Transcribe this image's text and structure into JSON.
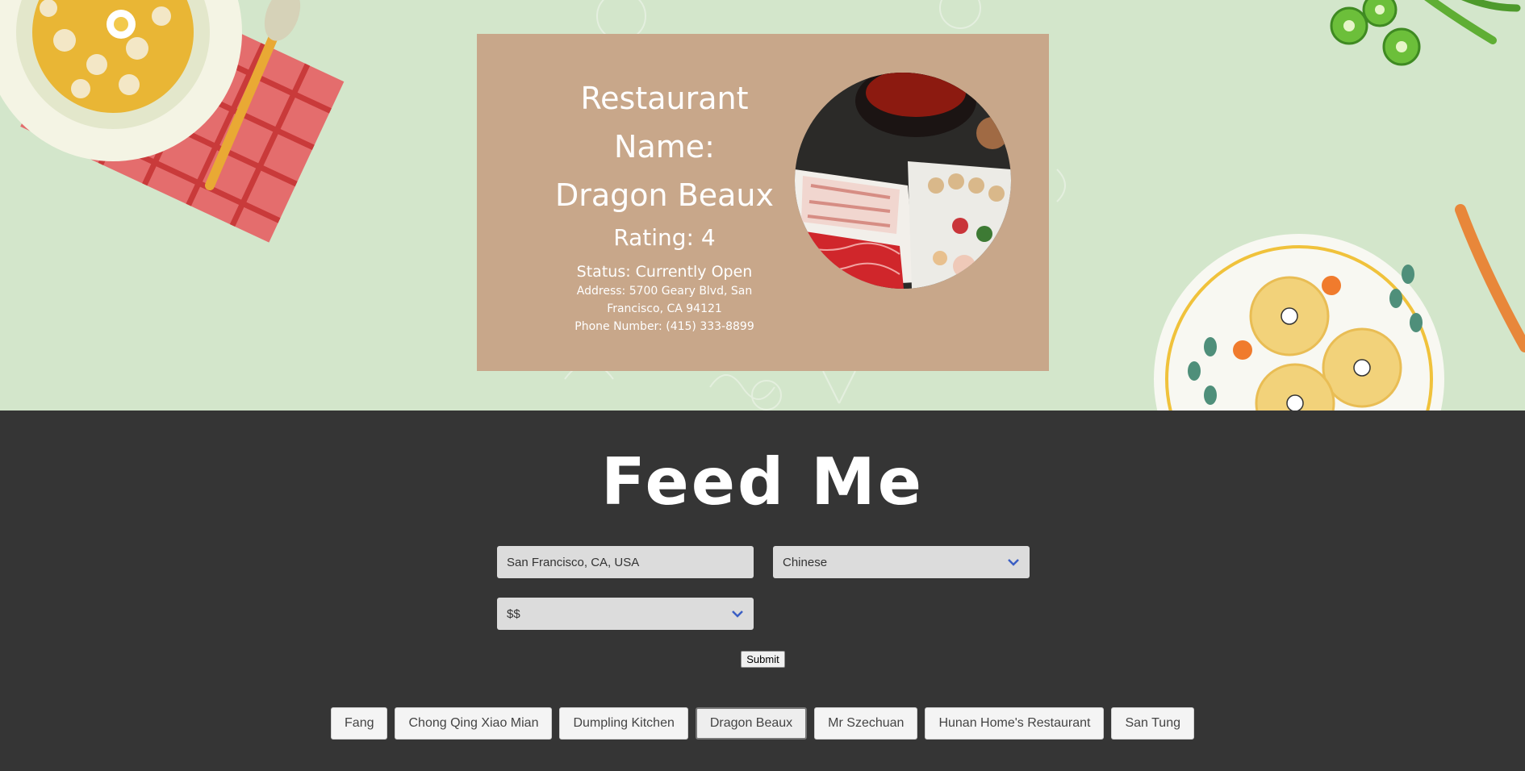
{
  "restaurant_card": {
    "name": "Restaurant Name: Dragon Beaux",
    "rating": "Rating: 4",
    "status": "Status: Currently Open",
    "address": "Address: 5700 Geary Blvd, San Francisco, CA 94121",
    "phone": "Phone Number: (415) 333-8899",
    "card_color": "#c8a78a"
  },
  "app": {
    "title": "Feed Me"
  },
  "search": {
    "location_value": "San Francisco, CA, USA",
    "cuisine_value": "Chinese",
    "price_value": "$$",
    "submit_label": "Submit"
  },
  "results": [
    {
      "label": "Fang",
      "active": false
    },
    {
      "label": "Chong Qing Xiao Mian",
      "active": false
    },
    {
      "label": "Dumpling Kitchen",
      "active": false
    },
    {
      "label": "Dragon Beaux",
      "active": true
    },
    {
      "label": "Mr Szechuan",
      "active": false
    },
    {
      "label": "Hunan Home's Restaurant",
      "active": false
    },
    {
      "label": "San Tung",
      "active": false
    }
  ],
  "colors": {
    "hero_bg": "#d3e6cb",
    "dark_bg": "#353535",
    "chevron": "#3b5fc4"
  }
}
